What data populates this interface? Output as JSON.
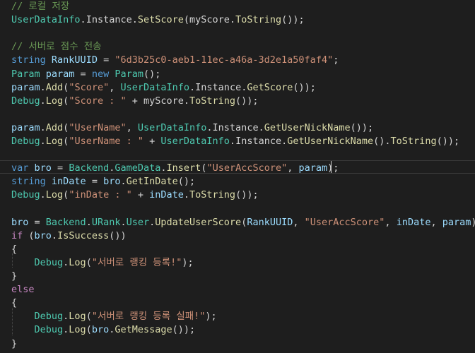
{
  "theme": {
    "background": "#1e1e1e",
    "default": "#d4d4d4",
    "comment": "#6a9955",
    "class": "#4ec9b0",
    "method": "#dcdcaa",
    "keyword": "#569cd6",
    "control": "#c586c0",
    "string": "#ce9178",
    "variable": "#9cdcfe"
  },
  "code_lines": [
    {
      "tokens": [
        {
          "t": "// 로컬 저장",
          "c": "comment"
        }
      ]
    },
    {
      "tokens": [
        {
          "t": "UserDataInfo",
          "c": "class"
        },
        {
          "t": ".",
          "c": "default"
        },
        {
          "t": "Instance",
          "c": "default"
        },
        {
          "t": ".",
          "c": "default"
        },
        {
          "t": "SetScore",
          "c": "method"
        },
        {
          "t": "(",
          "c": "default"
        },
        {
          "t": "myScore",
          "c": "default"
        },
        {
          "t": ".",
          "c": "default"
        },
        {
          "t": "ToString",
          "c": "method"
        },
        {
          "t": "());",
          "c": "default"
        }
      ]
    },
    {
      "tokens": []
    },
    {
      "tokens": [
        {
          "t": "// 서버로 점수 전송",
          "c": "comment"
        }
      ]
    },
    {
      "tokens": [
        {
          "t": "string",
          "c": "keyword"
        },
        {
          "t": " ",
          "c": "default"
        },
        {
          "t": "RankUUID",
          "c": "variable"
        },
        {
          "t": " = ",
          "c": "default"
        },
        {
          "t": "\"6d3b25c0-aeb1-11ec-a46a-3d2e1a50faf4\"",
          "c": "string"
        },
        {
          "t": ";",
          "c": "default"
        }
      ]
    },
    {
      "tokens": [
        {
          "t": "Param",
          "c": "class"
        },
        {
          "t": " ",
          "c": "default"
        },
        {
          "t": "param",
          "c": "variable"
        },
        {
          "t": " = ",
          "c": "default"
        },
        {
          "t": "new",
          "c": "keyword"
        },
        {
          "t": " ",
          "c": "default"
        },
        {
          "t": "Param",
          "c": "class"
        },
        {
          "t": "();",
          "c": "default"
        }
      ]
    },
    {
      "tokens": [
        {
          "t": "param",
          "c": "variable"
        },
        {
          "t": ".",
          "c": "default"
        },
        {
          "t": "Add",
          "c": "method"
        },
        {
          "t": "(",
          "c": "default"
        },
        {
          "t": "\"Score\"",
          "c": "string"
        },
        {
          "t": ", ",
          "c": "default"
        },
        {
          "t": "UserDataInfo",
          "c": "class"
        },
        {
          "t": ".",
          "c": "default"
        },
        {
          "t": "Instance",
          "c": "default"
        },
        {
          "t": ".",
          "c": "default"
        },
        {
          "t": "GetScore",
          "c": "method"
        },
        {
          "t": "());",
          "c": "default"
        }
      ]
    },
    {
      "tokens": [
        {
          "t": "Debug",
          "c": "class"
        },
        {
          "t": ".",
          "c": "default"
        },
        {
          "t": "Log",
          "c": "method"
        },
        {
          "t": "(",
          "c": "default"
        },
        {
          "t": "\"Score : \"",
          "c": "string"
        },
        {
          "t": " + myScore.",
          "c": "default"
        },
        {
          "t": "ToString",
          "c": "method"
        },
        {
          "t": "());",
          "c": "default"
        }
      ]
    },
    {
      "tokens": []
    },
    {
      "tokens": [
        {
          "t": "param",
          "c": "variable"
        },
        {
          "t": ".",
          "c": "default"
        },
        {
          "t": "Add",
          "c": "method"
        },
        {
          "t": "(",
          "c": "default"
        },
        {
          "t": "\"UserName\"",
          "c": "string"
        },
        {
          "t": ", ",
          "c": "default"
        },
        {
          "t": "UserDataInfo",
          "c": "class"
        },
        {
          "t": ".",
          "c": "default"
        },
        {
          "t": "Instance",
          "c": "default"
        },
        {
          "t": ".",
          "c": "default"
        },
        {
          "t": "GetUserNickName",
          "c": "method"
        },
        {
          "t": "());",
          "c": "default"
        }
      ]
    },
    {
      "tokens": [
        {
          "t": "Debug",
          "c": "class"
        },
        {
          "t": ".",
          "c": "default"
        },
        {
          "t": "Log",
          "c": "method"
        },
        {
          "t": "(",
          "c": "default"
        },
        {
          "t": "\"UserName : \"",
          "c": "string"
        },
        {
          "t": " + ",
          "c": "default"
        },
        {
          "t": "UserDataInfo",
          "c": "class"
        },
        {
          "t": ".",
          "c": "default"
        },
        {
          "t": "Instance",
          "c": "default"
        },
        {
          "t": ".",
          "c": "default"
        },
        {
          "t": "GetUserNickName",
          "c": "method"
        },
        {
          "t": "().",
          "c": "default"
        },
        {
          "t": "ToString",
          "c": "method"
        },
        {
          "t": "());",
          "c": "default"
        }
      ]
    },
    {
      "tokens": []
    },
    {
      "tokens": [
        {
          "t": "var",
          "c": "keyword"
        },
        {
          "t": " ",
          "c": "default"
        },
        {
          "t": "bro",
          "c": "variable"
        },
        {
          "t": " = ",
          "c": "default"
        },
        {
          "t": "Backend",
          "c": "class"
        },
        {
          "t": ".",
          "c": "default"
        },
        {
          "t": "GameData",
          "c": "class"
        },
        {
          "t": ".",
          "c": "default"
        },
        {
          "t": "Insert",
          "c": "method"
        },
        {
          "t": "(",
          "c": "default"
        },
        {
          "t": "\"UserAccScore\"",
          "c": "string"
        },
        {
          "t": ", ",
          "c": "default"
        },
        {
          "t": "param",
          "c": "variable"
        },
        {
          "t": ");",
          "c": "default"
        }
      ]
    },
    {
      "tokens": [
        {
          "t": "string",
          "c": "keyword"
        },
        {
          "t": " ",
          "c": "default"
        },
        {
          "t": "inDate",
          "c": "variable"
        },
        {
          "t": " = ",
          "c": "default"
        },
        {
          "t": "bro",
          "c": "variable"
        },
        {
          "t": ".",
          "c": "default"
        },
        {
          "t": "GetInDate",
          "c": "method"
        },
        {
          "t": "();",
          "c": "default"
        }
      ]
    },
    {
      "tokens": [
        {
          "t": "Debug",
          "c": "class"
        },
        {
          "t": ".",
          "c": "default"
        },
        {
          "t": "Log",
          "c": "method"
        },
        {
          "t": "(",
          "c": "default"
        },
        {
          "t": "\"inDate : \"",
          "c": "string"
        },
        {
          "t": " + ",
          "c": "default"
        },
        {
          "t": "inDate",
          "c": "variable"
        },
        {
          "t": ".",
          "c": "default"
        },
        {
          "t": "ToString",
          "c": "method"
        },
        {
          "t": "());",
          "c": "default"
        }
      ]
    },
    {
      "tokens": []
    },
    {
      "tokens": [
        {
          "t": "bro",
          "c": "variable"
        },
        {
          "t": " = ",
          "c": "default"
        },
        {
          "t": "Backend",
          "c": "class"
        },
        {
          "t": ".",
          "c": "default"
        },
        {
          "t": "URank",
          "c": "class"
        },
        {
          "t": ".",
          "c": "default"
        },
        {
          "t": "User",
          "c": "class"
        },
        {
          "t": ".",
          "c": "default"
        },
        {
          "t": "UpdateUserScore",
          "c": "method"
        },
        {
          "t": "(",
          "c": "default"
        },
        {
          "t": "RankUUID",
          "c": "variable"
        },
        {
          "t": ", ",
          "c": "default"
        },
        {
          "t": "\"UserAccScore\"",
          "c": "string"
        },
        {
          "t": ", ",
          "c": "default"
        },
        {
          "t": "inDate",
          "c": "variable"
        },
        {
          "t": ", ",
          "c": "default"
        },
        {
          "t": "param",
          "c": "variable"
        },
        {
          "t": ");",
          "c": "default"
        }
      ]
    },
    {
      "tokens": [
        {
          "t": "if",
          "c": "control"
        },
        {
          "t": " (",
          "c": "default"
        },
        {
          "t": "bro",
          "c": "variable"
        },
        {
          "t": ".",
          "c": "default"
        },
        {
          "t": "IsSuccess",
          "c": "method"
        },
        {
          "t": "())",
          "c": "default"
        }
      ]
    },
    {
      "tokens": [
        {
          "t": "{",
          "c": "default"
        }
      ]
    },
    {
      "tokens": [
        {
          "t": "    ",
          "c": "default"
        },
        {
          "t": "Debug",
          "c": "class"
        },
        {
          "t": ".",
          "c": "default"
        },
        {
          "t": "Log",
          "c": "method"
        },
        {
          "t": "(",
          "c": "default"
        },
        {
          "t": "\"서버로 랭킹 등록!\"",
          "c": "string"
        },
        {
          "t": ");",
          "c": "default"
        }
      ]
    },
    {
      "tokens": [
        {
          "t": "}",
          "c": "default"
        }
      ]
    },
    {
      "tokens": [
        {
          "t": "else",
          "c": "control"
        }
      ]
    },
    {
      "tokens": [
        {
          "t": "{",
          "c": "default"
        }
      ]
    },
    {
      "tokens": [
        {
          "t": "    ",
          "c": "default"
        },
        {
          "t": "Debug",
          "c": "class"
        },
        {
          "t": ".",
          "c": "default"
        },
        {
          "t": "Log",
          "c": "method"
        },
        {
          "t": "(",
          "c": "default"
        },
        {
          "t": "\"서버로 랭킹 등록 실패!\"",
          "c": "string"
        },
        {
          "t": ");",
          "c": "default"
        }
      ]
    },
    {
      "tokens": [
        {
          "t": "    ",
          "c": "default"
        },
        {
          "t": "Debug",
          "c": "class"
        },
        {
          "t": ".",
          "c": "default"
        },
        {
          "t": "Log",
          "c": "method"
        },
        {
          "t": "(",
          "c": "default"
        },
        {
          "t": "bro",
          "c": "variable"
        },
        {
          "t": ".",
          "c": "default"
        },
        {
          "t": "GetMessage",
          "c": "method"
        },
        {
          "t": "());",
          "c": "default"
        }
      ]
    },
    {
      "tokens": [
        {
          "t": "}",
          "c": "default"
        }
      ]
    }
  ]
}
